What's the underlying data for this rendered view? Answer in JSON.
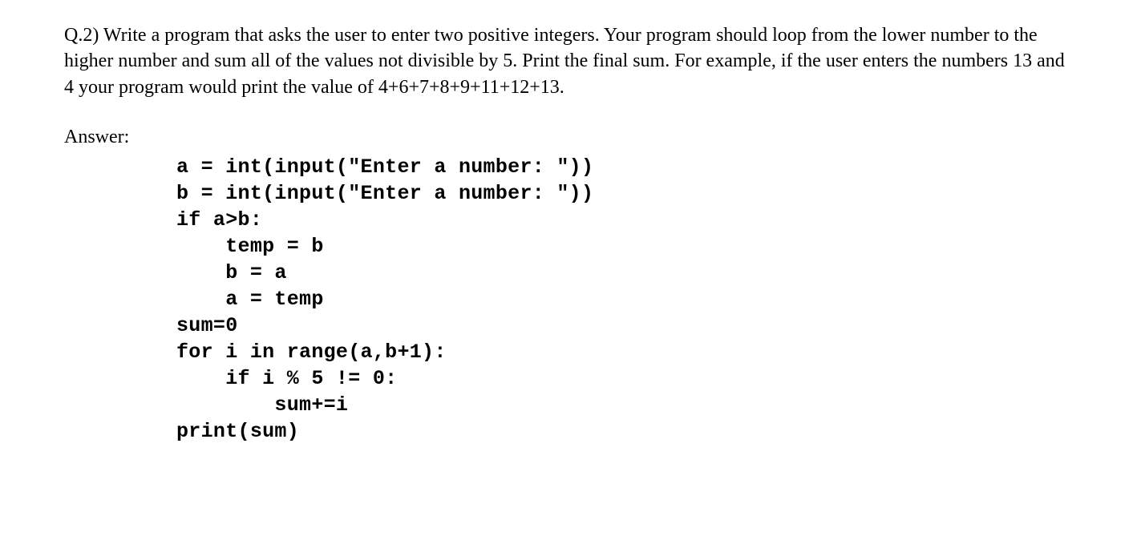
{
  "question": {
    "text": "Q.2) Write a program that asks the user to enter two positive integers. Your program should loop from the lower number to the higher number and sum all of the values not divisible by 5. Print the final sum. For example, if the user enters the numbers 13 and 4 your program would print the value of  4+6+7+8+9+11+12+13."
  },
  "answer_label": "Answer:",
  "code": {
    "lines": [
      "a = int(input(\"Enter a number: \"))",
      "b = int(input(\"Enter a number: \"))",
      "if a>b:",
      "    temp = b",
      "    b = a",
      "    a = temp",
      "sum=0",
      "for i in range(a,b+1):",
      "    if i % 5 != 0:",
      "        sum+=i",
      "print(sum)"
    ]
  }
}
